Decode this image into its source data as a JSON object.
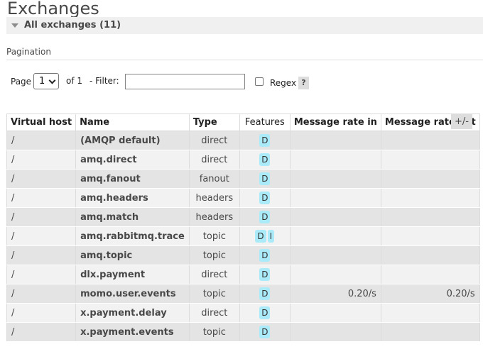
{
  "page": {
    "title": "Exchanges"
  },
  "section": {
    "header_label": "All exchanges (11)"
  },
  "pagination": {
    "title": "Pagination",
    "page_label": "Page",
    "page_value": "1",
    "of_label": "of 1",
    "filter_label": "- Filter:",
    "filter_value": "",
    "regex_label": "Regex",
    "help_label": "?"
  },
  "table": {
    "columns_toggle_label": "+/-",
    "headers": {
      "vhost": "Virtual host",
      "name": "Name",
      "type": "Type",
      "features": "Features",
      "rate_in": "Message rate in",
      "rate_out": "Message rate out"
    },
    "rows": [
      {
        "vhost": "/",
        "name": "(AMQP default)",
        "type": "direct",
        "features": [
          "D"
        ],
        "rate_in": "",
        "rate_out": ""
      },
      {
        "vhost": "/",
        "name": "amq.direct",
        "type": "direct",
        "features": [
          "D"
        ],
        "rate_in": "",
        "rate_out": ""
      },
      {
        "vhost": "/",
        "name": "amq.fanout",
        "type": "fanout",
        "features": [
          "D"
        ],
        "rate_in": "",
        "rate_out": ""
      },
      {
        "vhost": "/",
        "name": "amq.headers",
        "type": "headers",
        "features": [
          "D"
        ],
        "rate_in": "",
        "rate_out": ""
      },
      {
        "vhost": "/",
        "name": "amq.match",
        "type": "headers",
        "features": [
          "D"
        ],
        "rate_in": "",
        "rate_out": ""
      },
      {
        "vhost": "/",
        "name": "amq.rabbitmq.trace",
        "type": "topic",
        "features": [
          "D",
          "I"
        ],
        "rate_in": "",
        "rate_out": ""
      },
      {
        "vhost": "/",
        "name": "amq.topic",
        "type": "topic",
        "features": [
          "D"
        ],
        "rate_in": "",
        "rate_out": ""
      },
      {
        "vhost": "/",
        "name": "dlx.payment",
        "type": "direct",
        "features": [
          "D"
        ],
        "rate_in": "",
        "rate_out": ""
      },
      {
        "vhost": "/",
        "name": "momo.user.events",
        "type": "topic",
        "features": [
          "D"
        ],
        "rate_in": "0.20/s",
        "rate_out": "0.20/s"
      },
      {
        "vhost": "/",
        "name": "x.payment.delay",
        "type": "direct",
        "features": [
          "D"
        ],
        "rate_in": "",
        "rate_out": ""
      },
      {
        "vhost": "/",
        "name": "x.payment.events",
        "type": "topic",
        "features": [
          "D"
        ],
        "rate_in": "",
        "rate_out": ""
      }
    ]
  }
}
